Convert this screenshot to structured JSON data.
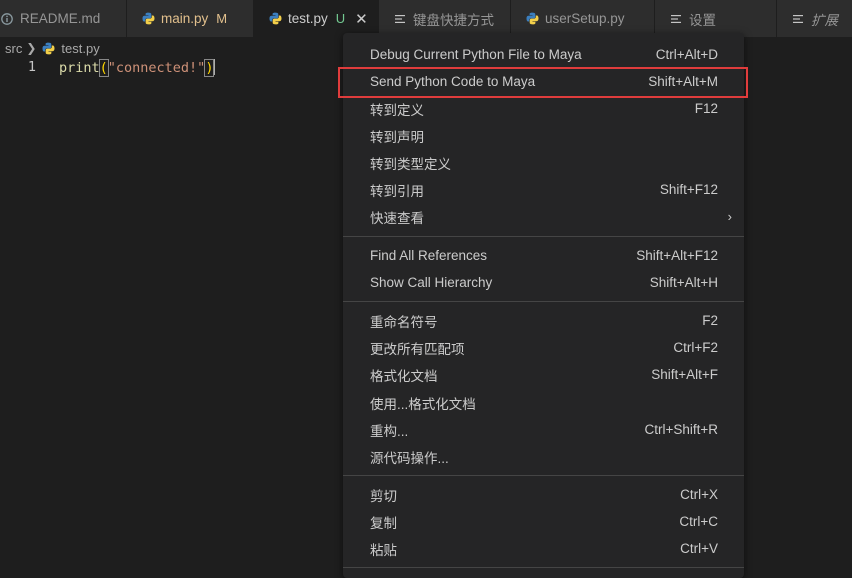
{
  "tabs": [
    {
      "label": "README.md",
      "icon": "info-icon"
    },
    {
      "label": "main.py",
      "mark": "M",
      "icon": "python-icon"
    },
    {
      "label": "test.py",
      "mark": "U",
      "icon": "python-icon",
      "active": true
    },
    {
      "label": "键盘快捷方式",
      "icon": "list-icon"
    },
    {
      "label": "userSetup.py",
      "icon": "python-icon"
    },
    {
      "label": "设置",
      "icon": "list-icon"
    },
    {
      "label": "扩展",
      "icon": "list-icon"
    }
  ],
  "breadcrumb": {
    "folder": "src",
    "file": "test.py"
  },
  "editor": {
    "line_number": "1",
    "code": {
      "fn": "print",
      "open": "(",
      "string": "\"connected!\"",
      "close": ")"
    }
  },
  "menu": {
    "items": [
      {
        "label": "Debug Current Python File to Maya",
        "shortcut": "Ctrl+Alt+D"
      },
      {
        "label": "Send Python Code to Maya",
        "shortcut": "Shift+Alt+M",
        "highlighted": true
      },
      {
        "label": "转到定义",
        "shortcut": "F12"
      },
      {
        "label": "转到声明",
        "shortcut": ""
      },
      {
        "label": "转到类型定义",
        "shortcut": ""
      },
      {
        "label": "转到引用",
        "shortcut": "Shift+F12"
      },
      {
        "label": "快速查看",
        "shortcut": "",
        "submenu": true
      },
      {
        "label": "Find All References",
        "shortcut": "Shift+Alt+F12"
      },
      {
        "label": "Show Call Hierarchy",
        "shortcut": "Shift+Alt+H"
      },
      {
        "label": "重命名符号",
        "shortcut": "F2"
      },
      {
        "label": "更改所有匹配项",
        "shortcut": "Ctrl+F2"
      },
      {
        "label": "格式化文档",
        "shortcut": "Shift+Alt+F"
      },
      {
        "label": "使用...格式化文档",
        "shortcut": ""
      },
      {
        "label": "重构...",
        "shortcut": "Ctrl+Shift+R"
      },
      {
        "label": "源代码操作...",
        "shortcut": ""
      },
      {
        "label": "剪切",
        "shortcut": "Ctrl+X"
      },
      {
        "label": "复制",
        "shortcut": "Ctrl+C"
      },
      {
        "label": "粘贴",
        "shortcut": "Ctrl+V"
      }
    ]
  },
  "colors": {
    "highlight_border": "#e03c3c",
    "modified": "#e2c08d",
    "untracked": "#73c991"
  }
}
